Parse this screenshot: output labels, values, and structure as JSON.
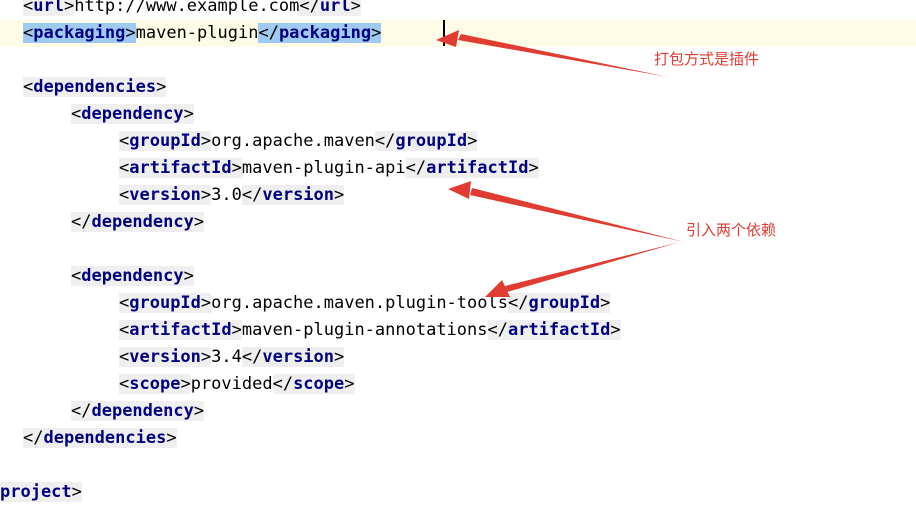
{
  "code": {
    "url_open": "url",
    "url_value": "http://www.example.com",
    "url_close": "url",
    "packaging_tag": "packaging",
    "packaging_value": "maven-plugin",
    "dependencies_tag": "dependencies",
    "dependency_tag": "dependency",
    "dep1": {
      "groupId_tag": "groupId",
      "groupId": "org.apache.maven",
      "artifactId_tag": "artifactId",
      "artifactId": "maven-plugin-api",
      "version_tag": "version",
      "version": "3.0"
    },
    "dep2": {
      "groupId_tag": "groupId",
      "groupId": "org.apache.maven.plugin-tools",
      "artifactId_tag": "artifactId",
      "artifactId": "maven-plugin-annotations",
      "version_tag": "version",
      "version": "3.4",
      "scope_tag": "scope",
      "scope": "provided"
    },
    "project_tag": "project"
  },
  "annotations": {
    "packaging_note": "打包方式是插件",
    "dependencies_note": "引入两个依赖"
  },
  "colors": {
    "tag": "#000080",
    "selection": "#9fcaf2",
    "token_background": "#efefef",
    "current_line": "#fefbe6",
    "annotation": "#e03c31"
  }
}
